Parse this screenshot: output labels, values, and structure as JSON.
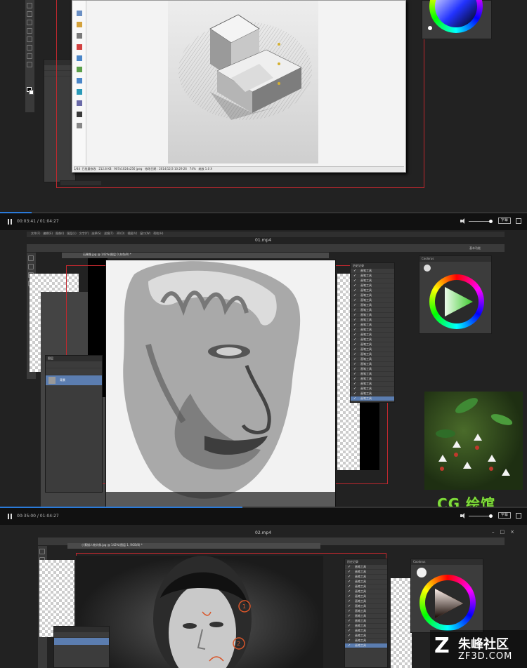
{
  "frame1": {
    "time": "00:03:41 / 01:04:27",
    "progress": 0.06,
    "subtitle_btn": "字幕",
    "viewer_status": [
      "1/44",
      "已批量修改",
      "212.8 KB",
      "907x1024x256 jpeg",
      "修改日期：2014/12/3 10:29:26",
      "74%",
      "缩放 1.0 X"
    ]
  },
  "frame2": {
    "file_title": "01.mp4",
    "time": "00:35:00 / 01:04:27",
    "progress": 0.46,
    "subtitle_btn": "字幕",
    "doc_tab": "石膏像.jpg @ 142%(图层 0,灰色/8) *",
    "layers_title": "图层",
    "layer_name": "背景",
    "history_title": "历史记录",
    "history_item": "画笔工具",
    "history_count": 27,
    "color_panel_title": "Coolorus",
    "workspace": "基本功能"
  },
  "frame3": {
    "file_title": "02.mp4",
    "doc_tab": "小素描人物头像.jpg @ 142%(图层 1, RGB/8) *",
    "history_title": "历史记录",
    "history_item": "画笔工具",
    "history_count": 17,
    "color_panel_title": "Coolorus",
    "annotation_numbers": [
      "1",
      "2"
    ]
  },
  "watermarks": {
    "cg_label": "CG 绘馆",
    "site_cn": "朱峰社区",
    "site_en": "ZF3D.COM"
  },
  "colors": {
    "progress_blue": "#2a7ad9",
    "guide_red": "#c0282e",
    "cg_green": "#7fdd3a",
    "selected_row": "#5b7db0"
  }
}
